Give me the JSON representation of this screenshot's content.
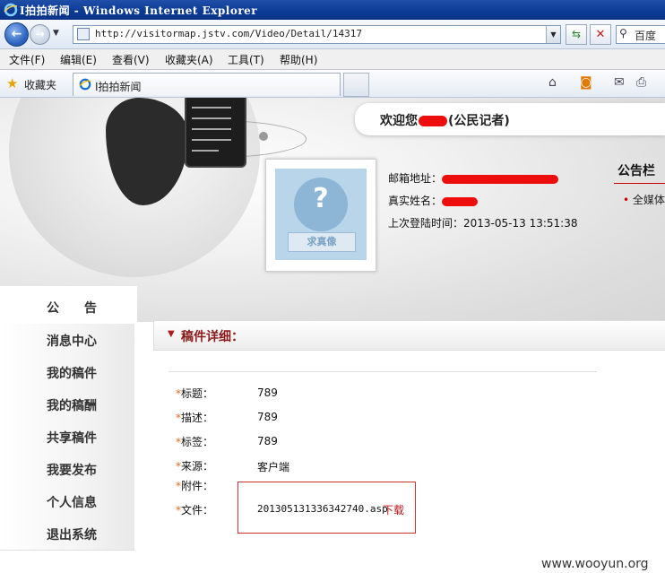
{
  "window": {
    "title": "I拍拍新闻 - Windows Internet Explorer"
  },
  "address_bar": {
    "url": "http://visitormap.jstv.com/Video/Detail/14317",
    "search_label": "百度"
  },
  "menu": [
    "文件(F)",
    "编辑(E)",
    "查看(V)",
    "收藏夹(A)",
    "工具(T)",
    "帮助(H)"
  ],
  "favorites": {
    "label": "收藏夹",
    "tab_title": "I拍拍新闻"
  },
  "header": {
    "welcome_prefix": "欢迎您",
    "welcome_suffix": "(公民记者)"
  },
  "profile": {
    "avatar_sign": "求真像",
    "email_label": "邮箱地址：",
    "realname_label": "真实姓名：",
    "lastlogin_label": "上次登陆时间：",
    "lastlogin_value": "2013-05-13 13:51:38"
  },
  "notice": {
    "title": "公告栏",
    "item": "全媒体"
  },
  "nav": {
    "header": "公　　告",
    "items": [
      "消息中心",
      "我的稿件",
      "我的稿酬",
      "共享稿件",
      "我要发布",
      "个人信息",
      "退出系统"
    ]
  },
  "detail": {
    "title": "稿件详细：",
    "fields": [
      {
        "label": "标题：",
        "value": "789"
      },
      {
        "label": "描述：",
        "value": "789"
      },
      {
        "label": "标签：",
        "value": "789"
      },
      {
        "label": "来源：",
        "value": "客户端"
      },
      {
        "label": "附件：",
        "value": ""
      },
      {
        "label": "文件：",
        "value": "201305131336342740.asp"
      }
    ],
    "download_label": "下载",
    "star": "*"
  },
  "watermark": "www.wooyun.org",
  "colors": {
    "accent_red": "#b8141b",
    "titlebar": "#0b3a94"
  }
}
